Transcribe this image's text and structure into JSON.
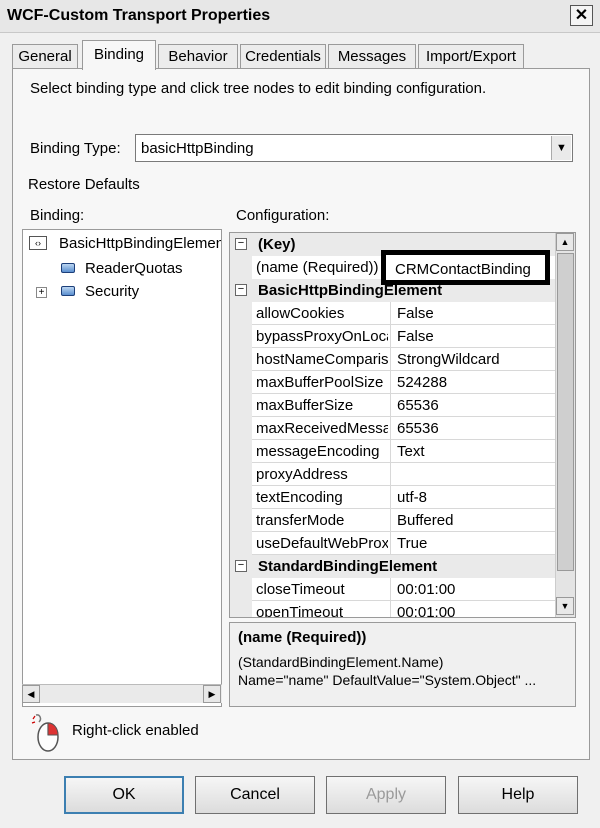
{
  "window": {
    "title": "WCF-Custom Transport Properties",
    "close_glyph": "✕"
  },
  "tabs": [
    {
      "label": "General"
    },
    {
      "label": "Binding"
    },
    {
      "label": "Behavior"
    },
    {
      "label": "Credentials"
    },
    {
      "label": "Messages"
    },
    {
      "label": "Import/Export"
    }
  ],
  "active_tab": "Binding",
  "instructions": "Select binding type and click tree nodes to edit binding configuration.",
  "binding_type": {
    "label": "Binding Type:",
    "value": "basicHttpBinding"
  },
  "restore_defaults": "Restore Defaults",
  "tree": {
    "label": "Binding:",
    "items": [
      {
        "label": "BasicHttpBindingElement"
      },
      {
        "label": "ReaderQuotas"
      },
      {
        "label": "Security"
      }
    ]
  },
  "config": {
    "label": "Configuration:",
    "categories": [
      {
        "label": "(Key)"
      },
      {
        "label": "BasicHttpBindingElement"
      },
      {
        "label": "StandardBindingElement"
      }
    ],
    "key_property": {
      "name": "(name (Required))",
      "value": "CRMContactBinding"
    },
    "basic_properties": [
      {
        "name": "allowCookies",
        "value": "False"
      },
      {
        "name": "bypassProxyOnLocal",
        "value": "False"
      },
      {
        "name": "hostNameComparisonMode",
        "value": "StrongWildcard"
      },
      {
        "name": "maxBufferPoolSize",
        "value": "524288"
      },
      {
        "name": "maxBufferSize",
        "value": "65536"
      },
      {
        "name": "maxReceivedMessageSize",
        "value": "65536"
      },
      {
        "name": "messageEncoding",
        "value": "Text"
      },
      {
        "name": "proxyAddress",
        "value": ""
      },
      {
        "name": "textEncoding",
        "value": "utf-8"
      },
      {
        "name": "transferMode",
        "value": "Buffered"
      },
      {
        "name": "useDefaultWebProxy",
        "value": "True"
      }
    ],
    "standard_properties": [
      {
        "name": "closeTimeout",
        "value": "00:01:00"
      },
      {
        "name": "openTimeout",
        "value": "00:01:00"
      }
    ]
  },
  "description": {
    "title": "(name (Required))",
    "line1": "(StandardBindingElement.Name)",
    "line2": "Name=\"name\" DefaultValue=\"System.Object\" ..."
  },
  "right_click": "Right-click enabled",
  "buttons": {
    "ok": "OK",
    "cancel": "Cancel",
    "apply": "Apply",
    "help": "Help"
  }
}
